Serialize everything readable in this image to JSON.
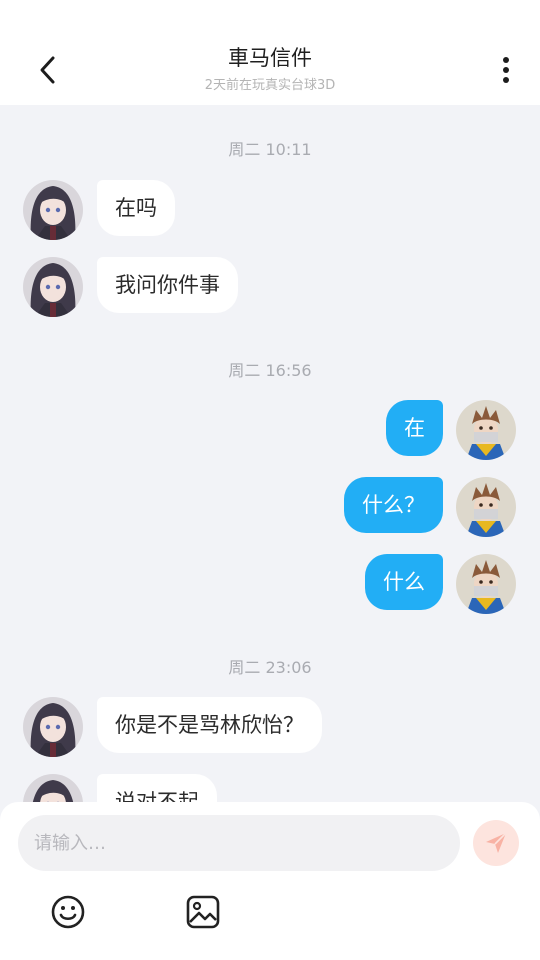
{
  "header": {
    "title": "車马信件",
    "subtitle": "2天前在玩真实台球3D",
    "back_icon": "chevron-left-icon",
    "more_icon": "more-vertical-icon"
  },
  "messages": {
    "timestamps": [
      "周二 10:11",
      "周二 16:56",
      "周二 23:06"
    ],
    "items": [
      {
        "side": "left",
        "text": "在吗"
      },
      {
        "side": "left",
        "text": "我问你件事"
      },
      {
        "side": "right",
        "text": "在"
      },
      {
        "side": "right",
        "text": "什么？"
      },
      {
        "side": "right",
        "text": "什么"
      },
      {
        "side": "left",
        "text": "你是不是骂林欣怡？"
      },
      {
        "side": "left",
        "text": "说对不起"
      }
    ]
  },
  "composer": {
    "placeholder": "请输入…",
    "send_icon": "send-icon",
    "emoji_icon": "emoji-icon",
    "image_icon": "image-icon"
  },
  "colors": {
    "accent": "#22aef5",
    "background": "#f2f3f7",
    "send_button": "#fde4de"
  }
}
